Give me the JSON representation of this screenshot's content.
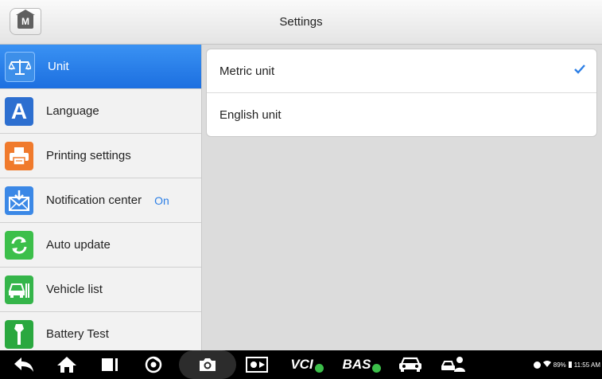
{
  "header": {
    "title": "Settings",
    "home_icon_letter": "M"
  },
  "sidebar": {
    "items": [
      {
        "label": "Unit",
        "icon": "balance-scale-icon",
        "active": true
      },
      {
        "label": "Language",
        "icon": "letter-a-icon"
      },
      {
        "label": "Printing settings",
        "icon": "printer-icon"
      },
      {
        "label": "Notification center",
        "icon": "mail-download-icon",
        "status": "On"
      },
      {
        "label": "Auto update",
        "icon": "refresh-icon"
      },
      {
        "label": "Vehicle list",
        "icon": "car-list-icon"
      },
      {
        "label": "Battery Test",
        "icon": "battery-tester-icon"
      }
    ]
  },
  "content": {
    "options": [
      {
        "label": "Metric unit",
        "selected": true
      },
      {
        "label": "English unit",
        "selected": false
      }
    ]
  },
  "navbar": {
    "vci_label": "VCI",
    "bas_label": "BAS",
    "status": {
      "battery": "89%",
      "time": "11:55 AM"
    }
  },
  "colors": {
    "accent": "#1c6fe0",
    "check": "#2c7fe6",
    "status_on": "#2c7fe6",
    "icon_unit": "#3a8de8",
    "icon_language": "#2d6fd0",
    "icon_printing": "#f07a2c",
    "icon_notification": "#3b88e6",
    "icon_update": "#3cbf4a",
    "icon_vehicle": "#35b54a",
    "icon_battery": "#2aa83f"
  }
}
